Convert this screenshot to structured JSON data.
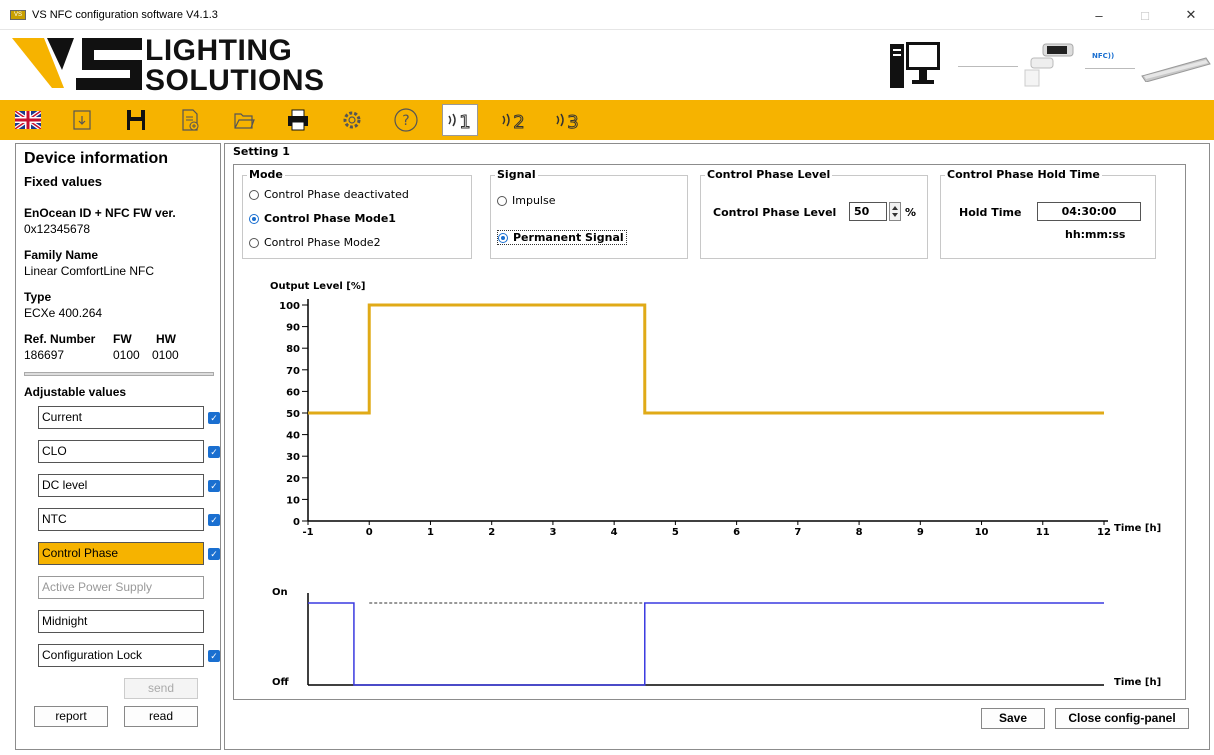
{
  "window": {
    "title": "VS NFC configuration software V4.1.3",
    "app_icon": "VS",
    "minimize": "–",
    "maximize": "□",
    "close": "✕"
  },
  "banner": {
    "logo_line1": "LIGHTING",
    "logo_line2": "SOLUTIONS",
    "nfc_label": "NFC))"
  },
  "toolbar": {
    "items": [
      "uk-flag-icon",
      "import-icon",
      "save-icon",
      "new-file-icon",
      "open-folder-icon",
      "print-icon",
      "settings-gear-icon",
      "help-icon",
      "setting-1-icon",
      "setting-2-icon",
      "setting-3-icon"
    ],
    "active": "setting-1-icon",
    "setting_numbers": [
      "1",
      "2",
      "3"
    ],
    "help_glyph": "?"
  },
  "device": {
    "title": "Device information",
    "fixed_title": "Fixed values",
    "id_label": "EnOcean ID + NFC FW ver.",
    "id_value": "0x12345678",
    "family_label": "Family Name",
    "family_value": "Linear ComfortLine NFC",
    "type_label": "Type",
    "type_value": "ECXe 400.264",
    "ref_label": "Ref. Number",
    "fw_label": "FW",
    "hw_label": "HW",
    "ref_value": "186697",
    "fw_value": "0100",
    "hw_value": "0100",
    "adjustable_title": "Adjustable values",
    "adjustable": [
      {
        "label": "Current",
        "checked": true
      },
      {
        "label": "CLO",
        "checked": true
      },
      {
        "label": "DC level",
        "checked": true
      },
      {
        "label": "NTC",
        "checked": true
      },
      {
        "label": "Control Phase",
        "checked": true
      },
      {
        "label": "Active Power Supply",
        "checked": false
      },
      {
        "label": "Midnight",
        "checked": false
      },
      {
        "label": "Configuration Lock",
        "checked": true
      }
    ],
    "check_glyph": "✓",
    "send": "send",
    "report": "report",
    "read": "read"
  },
  "setting": {
    "title": "Setting 1",
    "mode_title": "Mode",
    "mode_options": [
      "Control Phase deactivated",
      "Control Phase Mode1",
      "Control Phase Mode2"
    ],
    "mode_selected": 1,
    "signal_title": "Signal",
    "signal_options": [
      "Impulse",
      "Permanent Signal"
    ],
    "signal_selected": 1,
    "cpl_title": "Control Phase Level",
    "cpl_label": "Control Phase Level",
    "cpl_value": "50",
    "cpl_unit": "%",
    "hold_title": "Control Phase Hold Time",
    "hold_label": "Hold Time",
    "hold_value": "04:30:00",
    "hold_format": "hh:mm:ss",
    "save": "Save",
    "close_panel": "Close config-panel"
  },
  "chart_data": [
    {
      "type": "line",
      "title": "Output Level [%]",
      "xlabel": "Time [h]",
      "xlim": [
        -1,
        12
      ],
      "ylim": [
        0,
        100
      ],
      "x_ticks": [
        -1,
        0,
        1,
        2,
        3,
        4,
        5,
        6,
        7,
        8,
        9,
        10,
        11,
        12
      ],
      "y_ticks": [
        0,
        10,
        20,
        30,
        40,
        50,
        60,
        70,
        80,
        90,
        100
      ],
      "series": [
        {
          "color": "#e0aa17",
          "x": [
            -1,
            0,
            0,
            4.5,
            4.5,
            12
          ],
          "y": [
            50,
            50,
            100,
            100,
            50,
            50
          ]
        }
      ]
    },
    {
      "type": "line",
      "xlabel": "Time [h]",
      "y_labels": [
        "On",
        "Off"
      ],
      "series": [
        {
          "color": "#3a3ae0",
          "x": [
            -1,
            -0.25,
            -0.25,
            4.5,
            4.5,
            12
          ],
          "y": [
            1,
            1,
            0,
            0,
            1,
            1
          ]
        }
      ],
      "dashed_reference": {
        "x": [
          0,
          4.5
        ],
        "y": 1
      }
    }
  ]
}
